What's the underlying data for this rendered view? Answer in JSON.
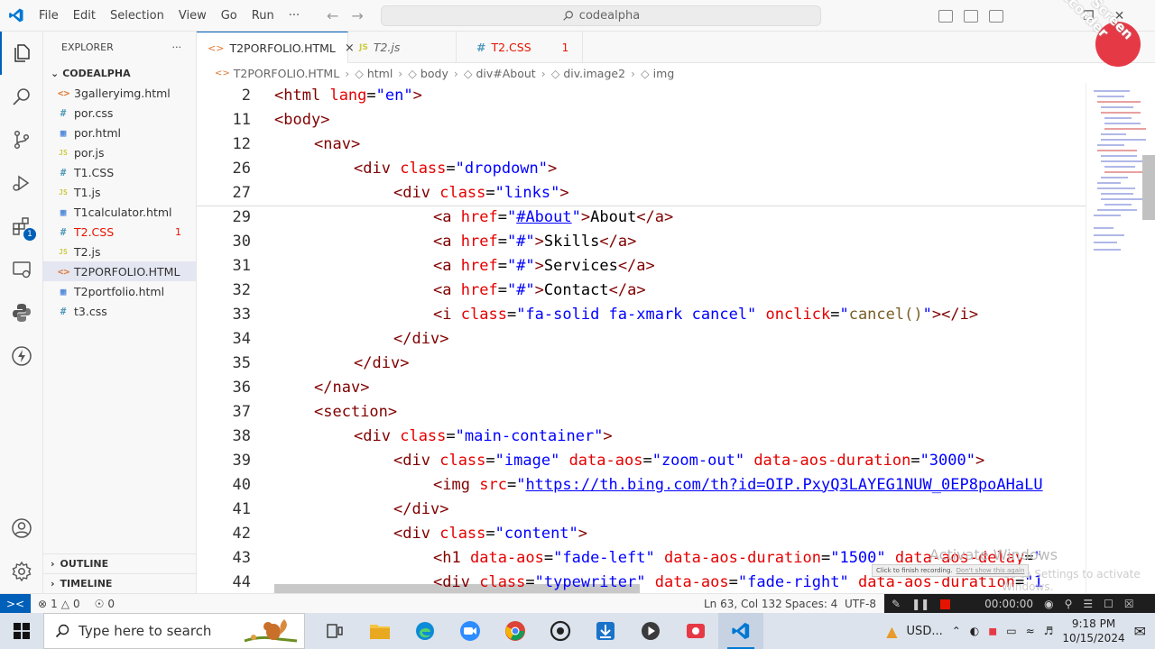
{
  "menu": [
    "File",
    "Edit",
    "Selection",
    "View",
    "Go",
    "Run",
    "···"
  ],
  "search": {
    "label": "codealpha"
  },
  "explorer": {
    "title": "EXPLORER",
    "more": "···",
    "folder": "CODEALPHA",
    "files": [
      {
        "name": "3galleryimg.html",
        "icon": "html"
      },
      {
        "name": "por.css",
        "icon": "css"
      },
      {
        "name": "por.html",
        "icon": "html-win"
      },
      {
        "name": "por.js",
        "icon": "js"
      },
      {
        "name": "T1.CSS",
        "icon": "css"
      },
      {
        "name": "T1.js",
        "icon": "js"
      },
      {
        "name": "T1calculator.html",
        "icon": "html-win"
      },
      {
        "name": "T2.CSS",
        "icon": "css",
        "count": "1"
      },
      {
        "name": "T2.js",
        "icon": "js"
      },
      {
        "name": "T2PORFOLIO.HTML",
        "icon": "html"
      },
      {
        "name": "T2portfolio.html",
        "icon": "html-win"
      },
      {
        "name": "t3.css",
        "icon": "css"
      }
    ],
    "outline": "OUTLINE",
    "timeline": "TIMELINE"
  },
  "tabs": [
    {
      "name": "T2PORFOLIO.HTML",
      "close": "×"
    },
    {
      "name": "T2.js"
    },
    {
      "name": "T2.CSS",
      "count": "1"
    }
  ],
  "breadcrumbs": [
    "T2PORFOLIO.HTML",
    "html",
    "body",
    "div#About",
    "div.image2",
    "img"
  ],
  "code": [
    {
      "ln": "2",
      "indent": 0,
      "html": "<span class='punct'>&lt;</span><span class='tag'>html</span> <span class='attr'>lang</span><span class='txt'>=</span><span class='str'>\"en\"</span><span class='punct'>&gt;</span>"
    },
    {
      "ln": "11",
      "indent": 0,
      "html": "<span class='punct'>&lt;</span><span class='tag'>body</span><span class='punct'>&gt;</span>"
    },
    {
      "ln": "12",
      "indent": 1,
      "html": "<span class='punct'>&lt;</span><span class='tag'>nav</span><span class='punct'>&gt;</span>"
    },
    {
      "ln": "26",
      "indent": 2,
      "html": "<span class='punct'>&lt;</span><span class='tag'>div</span> <span class='attr'>class</span><span class='txt'>=</span><span class='str'>\"dropdown\"</span><span class='punct'>&gt;</span>"
    },
    {
      "ln": "27",
      "indent": 3,
      "html": "<span class='punct'>&lt;</span><span class='tag'>div</span> <span class='attr'>class</span><span class='txt'>=</span><span class='str'>\"links\"</span><span class='punct'>&gt;</span>"
    },
    {
      "ln": "29",
      "indent": 4,
      "html": "<span class='punct'>&lt;</span><span class='tag'>a</span> <span class='attr'>href</span><span class='txt'>=</span><span class='str'>\"<u>#About</u>\"</span><span class='punct'>&gt;</span><span class='txt'>About</span><span class='punct'>&lt;/</span><span class='tag'>a</span><span class='punct'>&gt;</span>"
    },
    {
      "ln": "30",
      "indent": 4,
      "html": "<span class='punct'>&lt;</span><span class='tag'>a</span> <span class='attr'>href</span><span class='txt'>=</span><span class='str'>\"#\"</span><span class='punct'>&gt;</span><span class='txt'>Skills</span><span class='punct'>&lt;/</span><span class='tag'>a</span><span class='punct'>&gt;</span>"
    },
    {
      "ln": "31",
      "indent": 4,
      "html": "<span class='punct'>&lt;</span><span class='tag'>a</span> <span class='attr'>href</span><span class='txt'>=</span><span class='str'>\"#\"</span><span class='punct'>&gt;</span><span class='txt'>Services</span><span class='punct'>&lt;/</span><span class='tag'>a</span><span class='punct'>&gt;</span>"
    },
    {
      "ln": "32",
      "indent": 4,
      "html": "<span class='punct'>&lt;</span><span class='tag'>a</span> <span class='attr'>href</span><span class='txt'>=</span><span class='str'>\"#\"</span><span class='punct'>&gt;</span><span class='txt'>Contact</span><span class='punct'>&lt;/</span><span class='tag'>a</span><span class='punct'>&gt;</span>"
    },
    {
      "ln": "33",
      "indent": 4,
      "html": "<span class='punct'>&lt;</span><span class='tag'>i</span> <span class='attr'>class</span><span class='txt'>=</span><span class='str'>\"fa-solid fa-xmark cancel\"</span> <span class='attr'>onclick</span><span class='txt'>=</span><span class='str'>\"</span><span style='color:#795e26'>cancel()</span><span class='str'>\"</span><span class='punct'>&gt;&lt;/</span><span class='tag'>i</span><span class='punct'>&gt;</span>"
    },
    {
      "ln": "34",
      "indent": 3,
      "html": "<span class='punct'>&lt;/</span><span class='tag'>div</span><span class='punct'>&gt;</span>"
    },
    {
      "ln": "35",
      "indent": 2,
      "html": "<span class='punct'>&lt;/</span><span class='tag'>div</span><span class='punct'>&gt;</span>"
    },
    {
      "ln": "36",
      "indent": 1,
      "html": "<span class='punct'>&lt;/</span><span class='tag'>nav</span><span class='punct'>&gt;</span>"
    },
    {
      "ln": "37",
      "indent": 1,
      "html": "<span class='punct'>&lt;</span><span class='tag'>section</span><span class='punct'>&gt;</span>"
    },
    {
      "ln": "38",
      "indent": 2,
      "html": "<span class='punct'>&lt;</span><span class='tag'>div</span> <span class='attr'>class</span><span class='txt'>=</span><span class='str'>\"main-container\"</span><span class='punct'>&gt;</span>"
    },
    {
      "ln": "39",
      "indent": 3,
      "html": "<span class='punct'>&lt;</span><span class='tag'>div</span> <span class='attr'>class</span><span class='txt'>=</span><span class='str'>\"image\"</span> <span class='attr'>data-aos</span><span class='txt'>=</span><span class='str'>\"zoom-out\"</span> <span class='attr'>data-aos-duration</span><span class='txt'>=</span><span class='str'>\"3000\"</span><span class='punct'>&gt;</span>"
    },
    {
      "ln": "40",
      "indent": 4,
      "html": "<span class='punct'>&lt;</span><span class='tag'>img</span> <span class='attr'>src</span><span class='txt'>=</span><span class='str'>\"<span class='link'>https://th.bing.com/th?id=OIP.PxyQ3LAYEG1NUW_0EP8poAHaLU</span></span>"
    },
    {
      "ln": "41",
      "indent": 3,
      "html": "<span class='punct'>&lt;/</span><span class='tag'>div</span><span class='punct'>&gt;</span>"
    },
    {
      "ln": "42",
      "indent": 3,
      "html": "<span class='punct'>&lt;</span><span class='tag'>div</span> <span class='attr'>class</span><span class='txt'>=</span><span class='str'>\"content\"</span><span class='punct'>&gt;</span>"
    },
    {
      "ln": "43",
      "indent": 4,
      "html": "<span class='punct'>&lt;</span><span class='tag'>h1</span> <span class='attr'>data-aos</span><span class='txt'>=</span><span class='str'>\"fade-left\"</span> <span class='attr'>data-aos-duration</span><span class='txt'>=</span><span class='str'>\"1500\"</span> <span class='attr'>data-aos-delay</span><span class='txt'>=</span><span class='str'>\"</span>"
    },
    {
      "ln": "44",
      "indent": 4,
      "html": "<span class='punct'>&lt;</span><span class='tag'>div</span> <span class='attr'>class</span><span class='txt'>=</span><span class='str'>\"typewriter\"</span> <span class='attr'>data-aos</span><span class='txt'>=</span><span class='str'>\"fade-right\"</span> <span class='attr'>data-aos-duration</span><span class='txt'>=</span><span class='str'>\"1</span>"
    }
  ],
  "status": {
    "remote": "><",
    "errors": "1",
    "warnings": "0",
    "ports": "0",
    "position": "Ln 63, Col 132",
    "spaces": "Spaces: 4",
    "encoding": "UTF-8",
    "rec_time": "00:00:00"
  },
  "watermark": {
    "recorder": "iTop Screen Recorder",
    "activate": "Activate Windows",
    "activate_sub": "Go to Settings to activate Windows.",
    "tooltip": "Click to finish recording.",
    "tooltip_link": "Don't show this again"
  },
  "taskbar": {
    "search_placeholder": "Type here to search",
    "tray_currency": "USD...",
    "time": "9:18 PM",
    "date": "10/15/2024"
  },
  "colors": {
    "accent": "#005fb8",
    "error": "#e51400"
  }
}
